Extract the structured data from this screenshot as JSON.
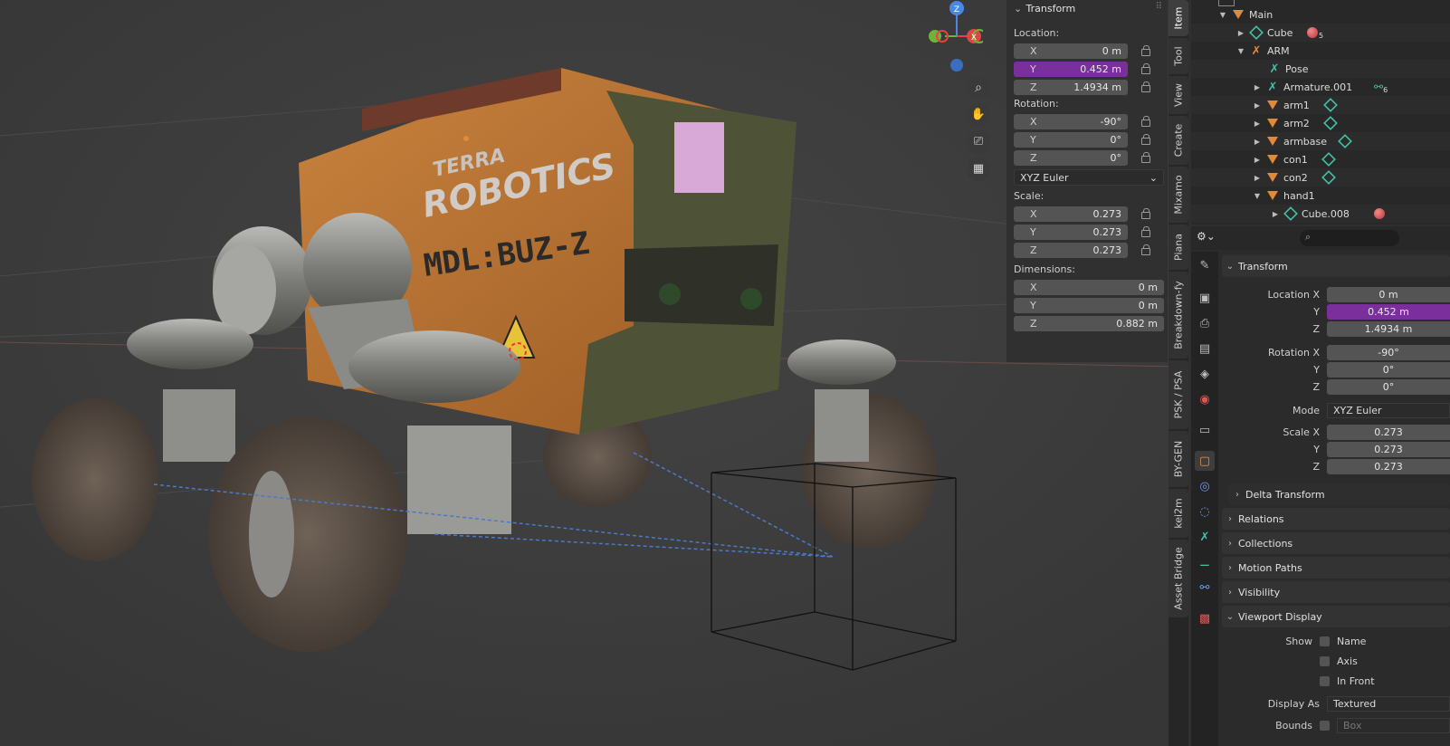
{
  "viewport": {
    "gizmo": {
      "z": "Z",
      "x": "X"
    },
    "decal_brand_line1": "TERRA",
    "decal_brand_line2": "ROBOTICS",
    "decal_model": "MDL:BUZ-Z"
  },
  "npanel": {
    "title": "Transform",
    "location_label": "Location:",
    "location": [
      {
        "axis": "X",
        "value": "0 m"
      },
      {
        "axis": "Y",
        "value": "0.452 m"
      },
      {
        "axis": "Z",
        "value": "1.4934 m"
      }
    ],
    "rotation_label": "Rotation:",
    "rotation": [
      {
        "axis": "X",
        "value": "-90°"
      },
      {
        "axis": "Y",
        "value": "0°"
      },
      {
        "axis": "Z",
        "value": "0°"
      }
    ],
    "rotation_mode": "XYZ Euler",
    "scale_label": "Scale:",
    "scale": [
      {
        "axis": "X",
        "value": "0.273"
      },
      {
        "axis": "Y",
        "value": "0.273"
      },
      {
        "axis": "Z",
        "value": "0.273"
      }
    ],
    "dimensions_label": "Dimensions:",
    "dimensions": [
      {
        "axis": "X",
        "value": "0 m"
      },
      {
        "axis": "Y",
        "value": "0 m"
      },
      {
        "axis": "Z",
        "value": "0.882 m"
      }
    ]
  },
  "tabs": [
    "Item",
    "Tool",
    "View",
    "Create",
    "Mixamo",
    "Piana",
    "Breakdown-fy",
    "PSK / PSA",
    "BY-GEN",
    "kei2m",
    "Asset Bridge"
  ],
  "outliner": {
    "rows": [
      {
        "name": "Main"
      },
      {
        "name": "Cube",
        "badge": "5"
      },
      {
        "name": "ARM"
      },
      {
        "name": "Pose"
      },
      {
        "name": "Armature.001",
        "badge": "6"
      },
      {
        "name": "arm1"
      },
      {
        "name": "arm2"
      },
      {
        "name": "armbase"
      },
      {
        "name": "con1"
      },
      {
        "name": "con2"
      },
      {
        "name": "hand1"
      },
      {
        "name": "Cube.008"
      }
    ]
  },
  "properties": {
    "transform_title": "Transform",
    "location_x_label": "Location X",
    "y_label": "Y",
    "z_label": "Z",
    "location_x": "0 m",
    "location_y": "0.452 m",
    "location_z": "1.4934 m",
    "rotation_x_label": "Rotation X",
    "rotation_x": "-90°",
    "rotation_y": "0°",
    "rotation_z": "0°",
    "mode_label": "Mode",
    "mode": "XYZ Euler",
    "scale_x_label": "Scale X",
    "scale_x": "0.273",
    "scale_y": "0.273",
    "scale_z": "0.273",
    "sections": [
      "Delta Transform",
      "Relations",
      "Collections",
      "Motion Paths",
      "Visibility",
      "Viewport Display"
    ],
    "show_label": "Show",
    "show_name": "Name",
    "show_axis": "Axis",
    "show_infront": "In Front",
    "display_as_label": "Display As",
    "display_as": "Textured",
    "bounds_label": "Bounds",
    "bounds": "Box"
  }
}
